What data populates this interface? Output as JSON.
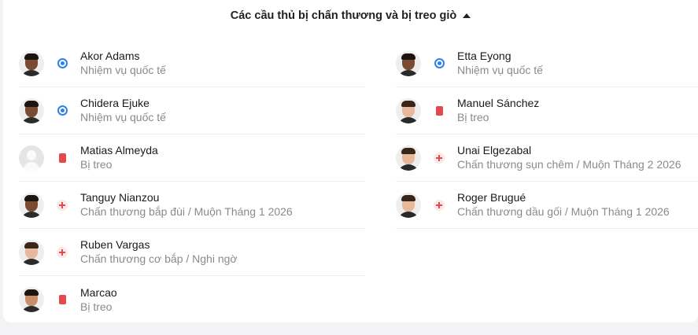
{
  "header": {
    "title": "Các cầu thủ bị chấn thương và bị treo giò",
    "toggle_icon": "caret-up-icon"
  },
  "colors": {
    "international_duty": "#2f80ed",
    "suspension": "#e5484d",
    "injury": "#e5484d",
    "secondary_text": "#8a8a8a"
  },
  "left_players": [
    {
      "name": "Akor Adams",
      "reason": "Nhiệm vụ quốc tế",
      "status_icon": "globe-icon"
    },
    {
      "name": "Chidera Ejuke",
      "reason": "Nhiệm vụ quốc tế",
      "status_icon": "globe-icon"
    },
    {
      "name": "Matias Almeyda",
      "reason": "Bị treo",
      "status_icon": "red-card-icon"
    },
    {
      "name": "Tanguy Nianzou",
      "reason": "Chấn thương bắp đùi / Muộn Tháng 1 2026",
      "status_icon": "injury-icon"
    },
    {
      "name": "Ruben Vargas",
      "reason": "Chấn thương cơ bắp / Nghi ngờ",
      "status_icon": "injury-icon"
    },
    {
      "name": "Marcao",
      "reason": "Bị treo",
      "status_icon": "red-card-icon"
    }
  ],
  "right_players": [
    {
      "name": "Etta Eyong",
      "reason": "Nhiệm vụ quốc tế",
      "status_icon": "globe-icon"
    },
    {
      "name": "Manuel Sánchez",
      "reason": "Bị treo",
      "status_icon": "red-card-icon"
    },
    {
      "name": "Unai Elgezabal",
      "reason": "Chấn thương sụn chêm / Muộn Tháng 2 2026",
      "status_icon": "injury-icon"
    },
    {
      "name": "Roger Brugué",
      "reason": "Chấn thương dầu gối / Muộn Tháng 1 2026",
      "status_icon": "injury-icon"
    }
  ]
}
